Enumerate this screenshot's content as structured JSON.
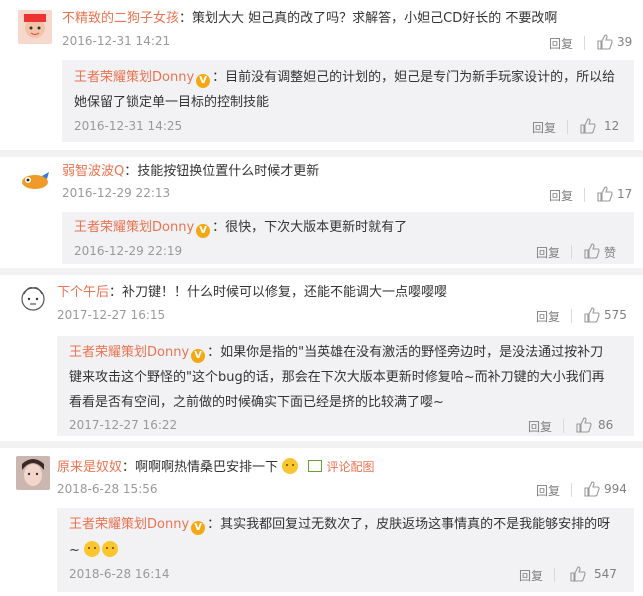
{
  "comments": [
    {
      "user": "不精致的二狗子女孩",
      "text": "策划大大 妲己真的改了吗？求解答，小妲己CD好长的 不要改啊",
      "time": "2016-12-31 14:21",
      "reply_label": "回复",
      "likes": "39",
      "reply": {
        "user": "王者荣耀策划Donny",
        "text_line1": "目前没有调整妲己的计划的，妲己是专门为新手玩家设计的，所以给",
        "text_line2": "她保留了锁定单一目标的控制技能",
        "time": "2016-12-31 14:25",
        "reply_label": "回复",
        "likes": "12"
      }
    },
    {
      "user": "弱智波波Q",
      "text": "技能按钮换位置什么时候才更新",
      "time": "2016-12-29 22:13",
      "reply_label": "回复",
      "likes": "17",
      "reply": {
        "user": "王者荣耀策划Donny",
        "text_line1": "很快，下次大版本更新时就有了",
        "time": "2016-12-29 22:19",
        "reply_label": "回复",
        "likes": "赞"
      }
    },
    {
      "user": "下个午后",
      "text": "补刀键！！什么时候可以修复，还能不能调大一点嘤嘤嘤",
      "time": "2017-12-27 16:15",
      "reply_label": "回复",
      "likes": "575",
      "reply": {
        "user": "王者荣耀策划Donny",
        "text_line1": "如果你是指的\"当英雄在没有激活的野怪旁边时，是没法通过按补刀",
        "text_line2": "键来攻击这个野怪的\"这个bug的话，那会在下次大版本更新时修复哈~而补刀键的大小我们再",
        "text_line3": "看看是否有空间，之前做的时候确实下面已经是挤的比较满了嘤~",
        "time": "2017-12-27 16:22",
        "reply_label": "回复",
        "likes": "86"
      }
    },
    {
      "user": "原来是奴奴",
      "text": "啊啊啊热情桑巴安排一下",
      "image_link": "评论配图",
      "time": "2018-6-28 15:56",
      "reply_label": "回复",
      "likes": "994",
      "reply": {
        "user": "王者荣耀策划Donny",
        "text_line1": "其实我都回复过无数次了，皮肤返场这事情真的不是我能够安排的呀",
        "text_line2": "~",
        "time": "2018-6-28 16:14",
        "reply_label": "回复",
        "likes": "547"
      }
    }
  ],
  "separators": {
    "colon": "："
  }
}
